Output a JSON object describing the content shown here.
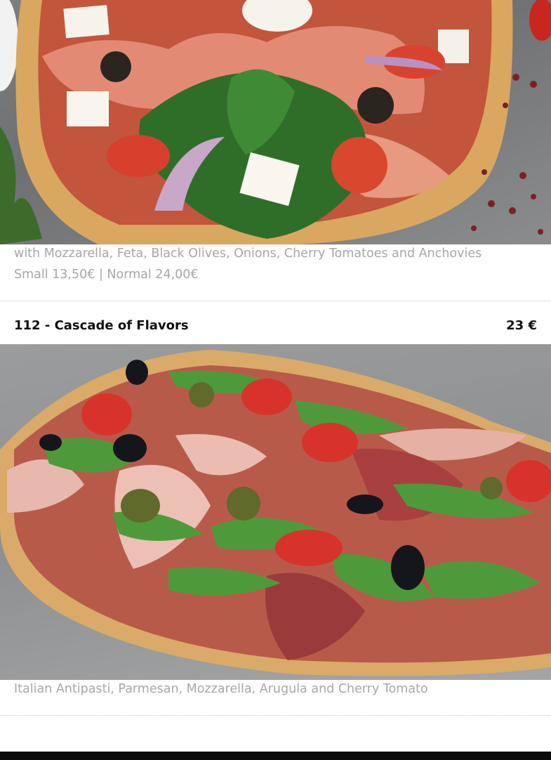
{
  "items": [
    {
      "description": "with Mozzarella, Feta, Black Olives, Onions, Cherry Tomatoes and Anchovies",
      "prices_line": "Small 13,50€ | Normal 24,00€"
    },
    {
      "title": "112 - Cascade of Flavors",
      "price": "23 €",
      "description": "Italian Antipasti, Parmesan, Mozzarella, Arugula and Cherry Tomato"
    }
  ]
}
